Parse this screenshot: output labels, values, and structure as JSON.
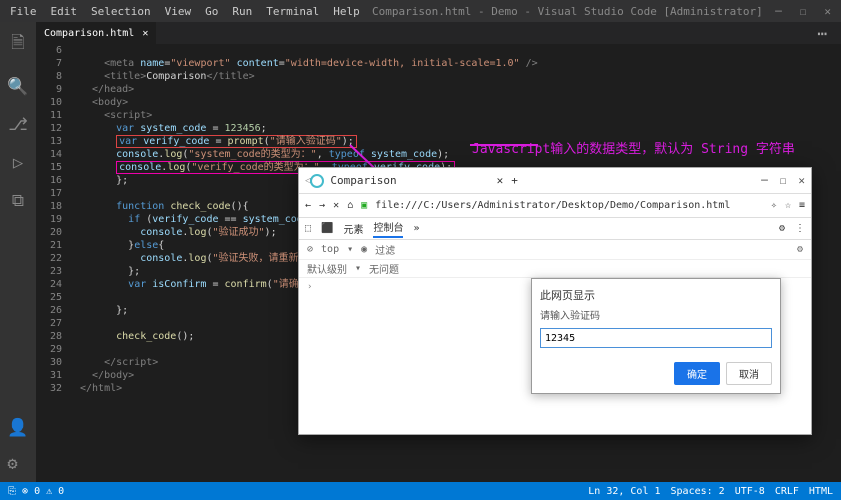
{
  "titlebar": {
    "title": "Comparison.html - Demo - Visual Studio Code [Administrator]"
  },
  "menu": {
    "file": "File",
    "edit": "Edit",
    "selection": "Selection",
    "view": "View",
    "go": "Go",
    "run": "Run",
    "terminal": "Terminal",
    "help": "Help"
  },
  "tab": {
    "name": "Comparison.html"
  },
  "lines": [
    "6",
    "7",
    "8",
    "9",
    "10",
    "11",
    "12",
    "13",
    "14",
    "15",
    "16",
    "17",
    "18",
    "19",
    "20",
    "21",
    "22",
    "23",
    "24",
    "25",
    "26",
    "27",
    "28",
    "29",
    "30",
    "31",
    "32"
  ],
  "annotation": "Javascript输入的数据类型，默认为 String 字符串",
  "browser": {
    "tab": "Comparison",
    "url": "file:///C:/Users/Administrator/Desktop/Demo/Comparison.html",
    "dev_elements": "元素",
    "dev_console": "控制台",
    "filter": "过滤",
    "default_level": "默认级别",
    "top": "top",
    "no_issue": "无问题"
  },
  "prompt": {
    "title": "此网页显示",
    "msg": "请输入验证码",
    "value": "12345",
    "ok": "确定",
    "cancel": "取消"
  },
  "status": {
    "lncol": "Ln 32, Col 1",
    "spaces": "Spaces: 2",
    "enc": "UTF-8",
    "eol": "CRLF",
    "lang": "HTML"
  }
}
